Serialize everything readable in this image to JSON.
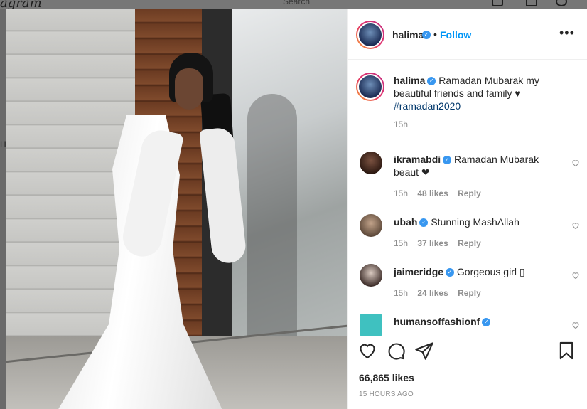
{
  "background": {
    "logo": "agram",
    "search_placeholder": "Search",
    "side_letter": "H"
  },
  "post": {
    "username": "halima",
    "follow_label": "Follow",
    "separator": "•",
    "more_label": "•••",
    "caption": {
      "username": "halima",
      "text": "Ramadan Mubarak my beautiful friends and family ♥",
      "hashtag": "#ramadan2020",
      "time": "15h"
    },
    "comments": [
      {
        "username": "ikramabdi",
        "text": "Ramadan Mubarak beaut ❤",
        "time": "15h",
        "likes": "48 likes",
        "reply": "Reply"
      },
      {
        "username": "ubah",
        "text": "Stunning MashAllah",
        "time": "15h",
        "likes": "37 likes",
        "reply": "Reply"
      },
      {
        "username": "jaimeridge",
        "text": "Gorgeous girl ▯",
        "time": "15h",
        "likes": "24 likes",
        "reply": "Reply"
      },
      {
        "username": "humansoffashionf",
        "text": "",
        "time": "",
        "likes": "",
        "reply": ""
      }
    ],
    "likes_count": "66,865 likes",
    "posted": "15 HOURS AGO"
  },
  "icons": {
    "like": "heart-icon",
    "comment": "comment-icon",
    "share": "share-icon",
    "save": "bookmark-icon",
    "verified": "verified-badge-icon"
  },
  "colors": {
    "link_blue": "#0095f6",
    "hashtag_blue": "#00376b",
    "verified_blue": "#3897f0",
    "muted_text": "#8e8e8e"
  }
}
